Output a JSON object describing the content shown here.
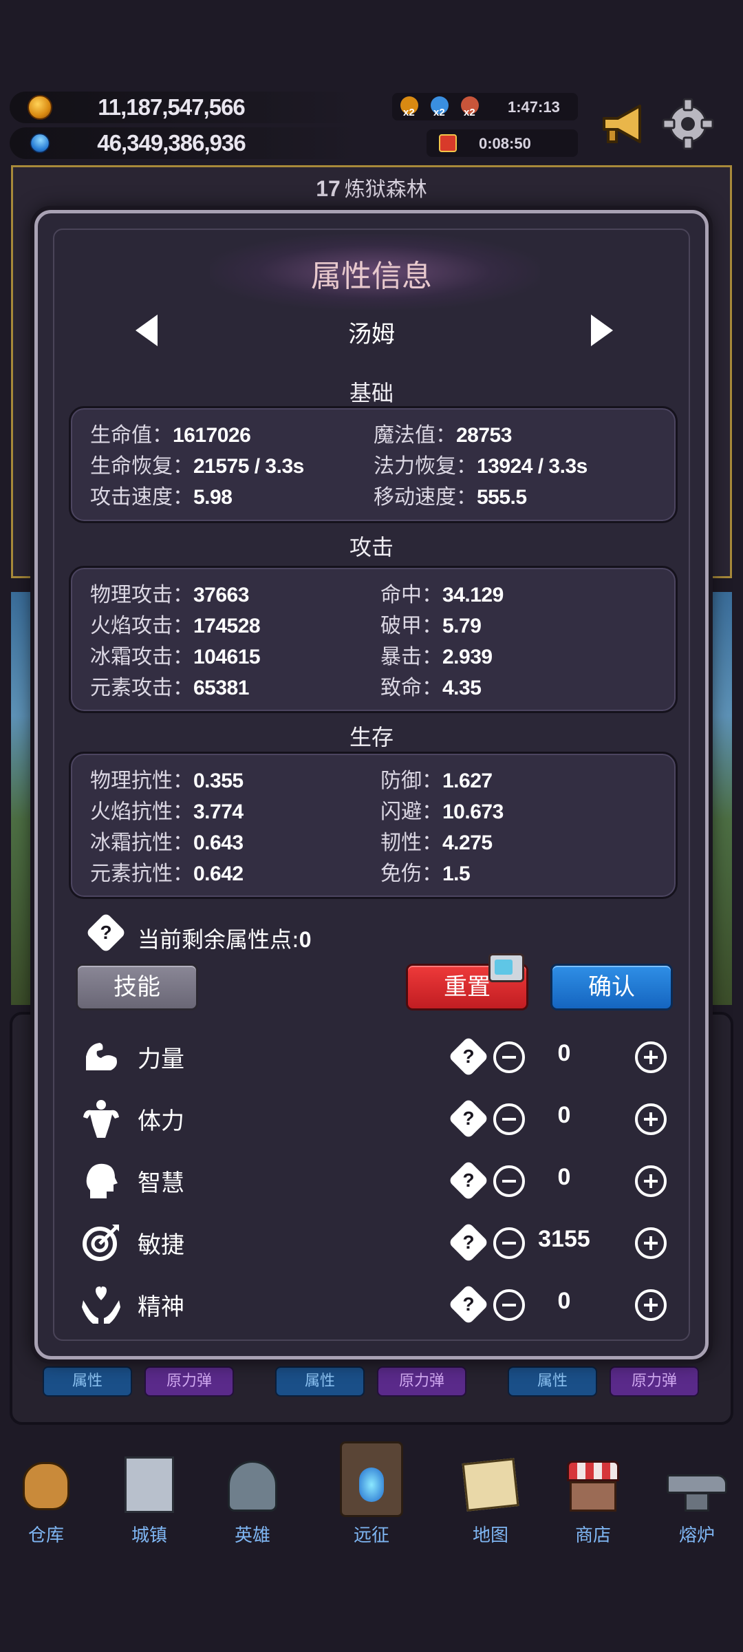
{
  "hud": {
    "gold": "11,187,547,566",
    "gems": "46,349,386,936",
    "boost_multipliers": [
      "x2",
      "x2",
      "x2"
    ],
    "boost_timer": "1:47:13",
    "gift_timer": "0:08:50"
  },
  "stage": {
    "number": "17",
    "name": "炼狱森林"
  },
  "modal": {
    "title": "属性信息",
    "hero_name": "汤姆",
    "sections": {
      "basic": {
        "title": "基础",
        "stats": [
          {
            "label": "生命值：",
            "value": "1617026"
          },
          {
            "label": "魔法值：",
            "value": "28753"
          },
          {
            "label": "生命恢复：",
            "value": "21575 / 3.3s"
          },
          {
            "label": "法力恢复：",
            "value": "13924 / 3.3s"
          },
          {
            "label": "攻击速度：",
            "value": "5.98"
          },
          {
            "label": "移动速度：",
            "value": "555.5"
          }
        ]
      },
      "attack": {
        "title": "攻击",
        "stats": [
          {
            "label": "物理攻击：",
            "value": "37663"
          },
          {
            "label": "命中：",
            "value": "34.129"
          },
          {
            "label": "火焰攻击：",
            "value": "174528"
          },
          {
            "label": "破甲：",
            "value": "5.79"
          },
          {
            "label": "冰霜攻击：",
            "value": "104615"
          },
          {
            "label": "暴击：",
            "value": "2.939"
          },
          {
            "label": "元素攻击：",
            "value": "65381"
          },
          {
            "label": "致命：",
            "value": "4.35"
          }
        ]
      },
      "survival": {
        "title": "生存",
        "stats": [
          {
            "label": "物理抗性：",
            "value": "0.355"
          },
          {
            "label": "防御：",
            "value": "1.627"
          },
          {
            "label": "火焰抗性：",
            "value": "3.774"
          },
          {
            "label": "闪避：",
            "value": "10.673"
          },
          {
            "label": "冰霜抗性：",
            "value": "0.643"
          },
          {
            "label": "韧性：",
            "value": "4.275"
          },
          {
            "label": "元素抗性：",
            "value": "0.642"
          },
          {
            "label": "免伤：",
            "value": "1.5"
          }
        ]
      }
    },
    "remaining_points_label": "当前剩余属性点:",
    "remaining_points": "0",
    "buttons": {
      "skill": "技能",
      "reset": "重置",
      "confirm": "确认"
    },
    "attributes": [
      {
        "name": "力量",
        "icon": "muscle-arm-icon",
        "value": "0"
      },
      {
        "name": "体力",
        "icon": "strong-body-icon",
        "value": "0"
      },
      {
        "name": "智慧",
        "icon": "head-brain-icon",
        "value": "0"
      },
      {
        "name": "敏捷",
        "icon": "target-arrow-icon",
        "value": "3155"
      },
      {
        "name": "精神",
        "icon": "hands-heart-icon",
        "value": "0"
      }
    ],
    "help_mark": "?"
  },
  "team_slots": [
    {
      "attr": "属性",
      "force": "原力弹"
    },
    {
      "attr": "属性",
      "force": "原力弹"
    },
    {
      "attr": "属性",
      "force": "原力弹"
    }
  ],
  "nav": [
    {
      "label": "仓库",
      "icon": "bag-icon"
    },
    {
      "label": "城镇",
      "icon": "castle-icon"
    },
    {
      "label": "英雄",
      "icon": "helmet-icon"
    },
    {
      "label": "远征",
      "icon": "portal-icon"
    },
    {
      "label": "地图",
      "icon": "map-icon"
    },
    {
      "label": "商店",
      "icon": "shop-icon"
    },
    {
      "label": "熔炉",
      "icon": "anvil-icon"
    }
  ],
  "colors": {
    "panel": "#2b2737",
    "reset_button": "#d42a2e",
    "confirm_button": "#1f77d2",
    "skill_button": "#7a7786",
    "nav_label": "#7fb6f3"
  }
}
